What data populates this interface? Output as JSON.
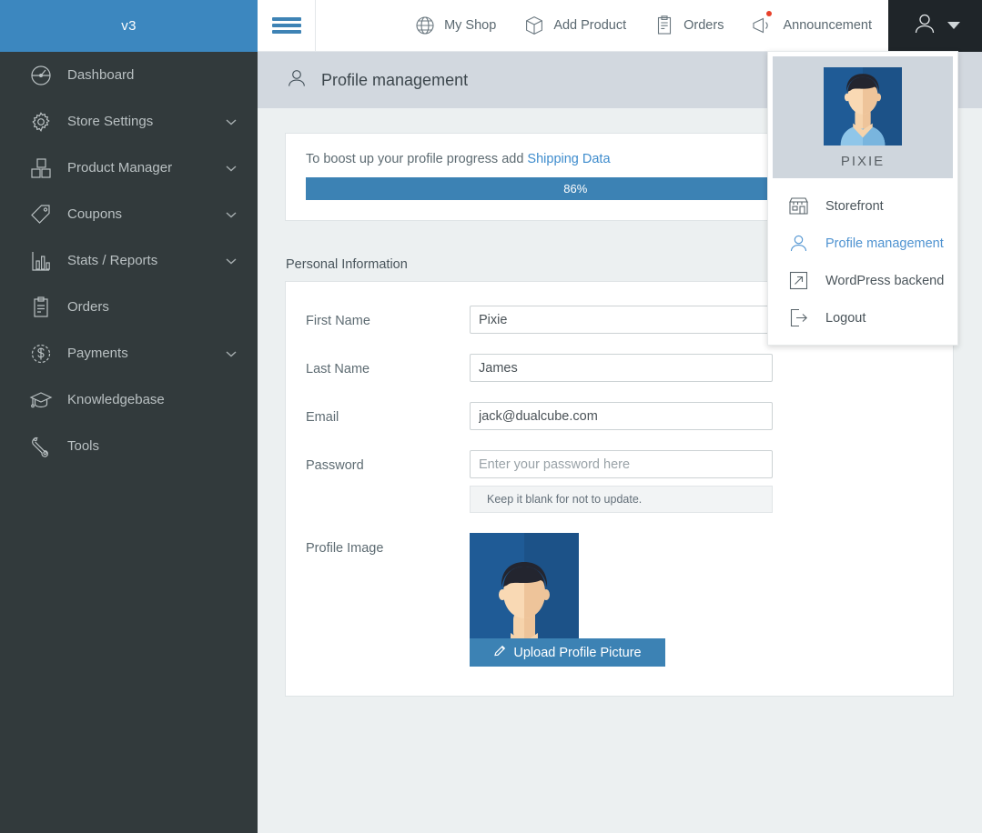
{
  "sidebar": {
    "brand": "v3",
    "items": [
      {
        "label": "Dashboard",
        "icon": "dashboard-icon",
        "caret": false
      },
      {
        "label": "Store Settings",
        "icon": "gear-icon",
        "caret": true
      },
      {
        "label": "Product Manager",
        "icon": "boxes-icon",
        "caret": true
      },
      {
        "label": "Coupons",
        "icon": "tag-icon",
        "caret": true
      },
      {
        "label": "Stats / Reports",
        "icon": "bar-chart-icon",
        "caret": true
      },
      {
        "label": "Orders",
        "icon": "clipboard-icon",
        "caret": false
      },
      {
        "label": "Payments",
        "icon": "dollar-circle-icon",
        "caret": true
      },
      {
        "label": "Knowledgebase",
        "icon": "graduation-cap-icon",
        "caret": false
      },
      {
        "label": "Tools",
        "icon": "wrench-icon",
        "caret": false
      }
    ]
  },
  "topbar": {
    "menu_icon": "hamburger-icon",
    "items": [
      {
        "label": "My Shop",
        "icon": "globe-icon",
        "badge": false
      },
      {
        "label": "Add Product",
        "icon": "cube-icon",
        "badge": false
      },
      {
        "label": "Orders",
        "icon": "clipboard-icon",
        "badge": false
      },
      {
        "label": "Announcement",
        "icon": "megaphone-icon",
        "badge": true
      }
    ],
    "user_icon": "user-icon",
    "user_caret_icon": "caret-down-icon"
  },
  "user_menu": {
    "avatar_icon": "user-avatar-image",
    "username": "PIXIE",
    "items": [
      {
        "label": "Storefront",
        "icon": "storefront-icon",
        "active": false
      },
      {
        "label": "Profile management",
        "icon": "user-icon",
        "active": true
      },
      {
        "label": "WordPress backend",
        "icon": "external-link-icon",
        "active": false
      },
      {
        "label": "Logout",
        "icon": "logout-icon",
        "active": false
      }
    ]
  },
  "page": {
    "title": "Profile management",
    "title_icon": "user-icon"
  },
  "progress": {
    "message_prefix": "To boost up your profile progress add ",
    "link_label": "Shipping Data",
    "percent_label": "86%",
    "percent_value": 86,
    "bar_color": "#3c82b4"
  },
  "form": {
    "section_label": "Personal Information",
    "fields": [
      {
        "label": "First Name",
        "value": "Pixie",
        "placeholder": ""
      },
      {
        "label": "Last Name",
        "value": "James",
        "placeholder": ""
      },
      {
        "label": "Email",
        "value": "jack@dualcube.com",
        "placeholder": ""
      }
    ],
    "password": {
      "label": "Password",
      "value": "",
      "placeholder": "Enter your password here",
      "note": "Keep it blank for not to update."
    },
    "profile_image": {
      "label": "Profile Image",
      "image_icon": "user-avatar-image",
      "upload_label": "Upload Profile Picture",
      "upload_icon": "pencil-icon"
    }
  },
  "colors": {
    "brand_blue": "#3c87bf",
    "accent_blue": "#3c82b4",
    "link_blue": "#3e8ccd",
    "sidebar_dark": "#323a3c",
    "user_btn_dark": "#1f2529",
    "page_header_gray": "#d2d8df",
    "content_bg": "#ecf0f1"
  }
}
